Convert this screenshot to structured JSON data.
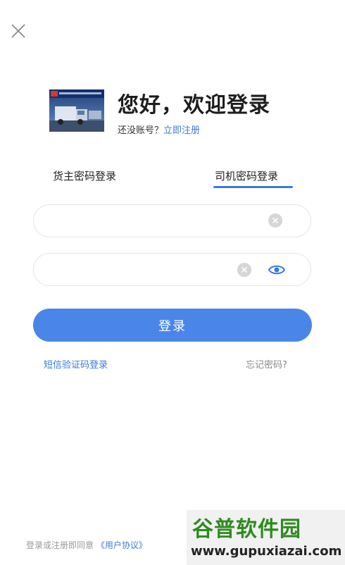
{
  "close": {
    "icon": "close-icon"
  },
  "header": {
    "greeting": "您好，欢迎登录",
    "no_account": "还没账号？",
    "register": "立即注册"
  },
  "tabs": [
    {
      "label": "货主密码登录",
      "active": false
    },
    {
      "label": "司机密码登录",
      "active": true
    }
  ],
  "form": {
    "account_value": "",
    "password_value": "",
    "clear_icon": "clear-icon",
    "eye_icon": "eye-icon",
    "login_label": "登录"
  },
  "links": {
    "sms_login": "短信验证码登录",
    "forgot_password": "忘记密码?"
  },
  "agreement": {
    "text": "登录或注册即同意 ",
    "link": "《用户协议》"
  },
  "watermark": {
    "title": "谷普软件园",
    "url": "www.gupuxiazai.com"
  },
  "colors": {
    "accent": "#4a86e8",
    "link": "#3a7bd8",
    "watermark_green": "#2e8b1f"
  }
}
